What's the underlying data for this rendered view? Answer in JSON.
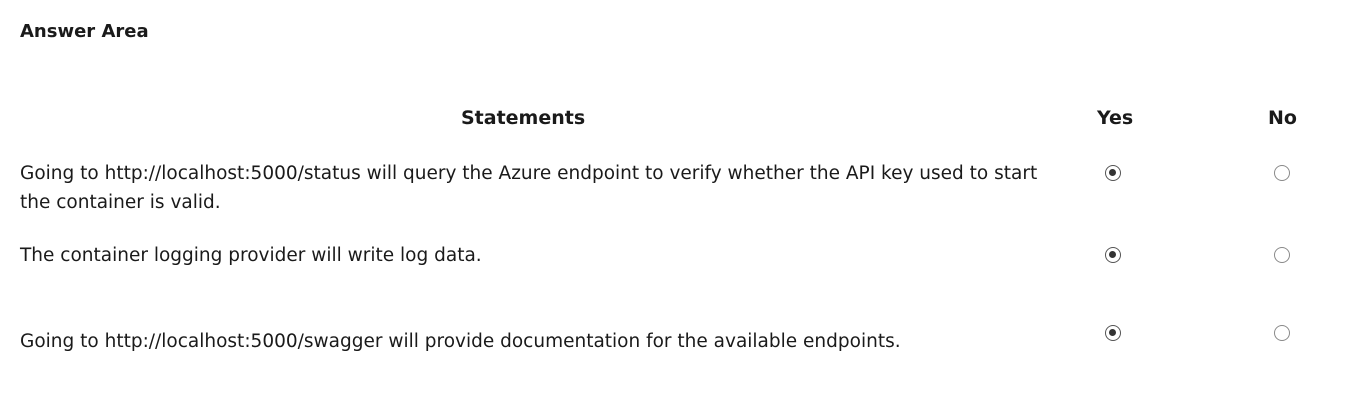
{
  "answer_area": {
    "title": "Answer Area"
  },
  "table": {
    "headers": {
      "statements": "Statements",
      "yes": "Yes",
      "no": "No"
    },
    "rows": [
      {
        "statement": "Going to http://localhost:5000/status will query the Azure endpoint to verify whether the API key used to start the container is valid.",
        "selected": "yes"
      },
      {
        "statement": "The container logging provider will write log data.",
        "selected": "yes"
      },
      {
        "statement": "Going to http://localhost:5000/swagger will provide documentation for the available endpoints.",
        "selected": "yes"
      }
    ]
  }
}
